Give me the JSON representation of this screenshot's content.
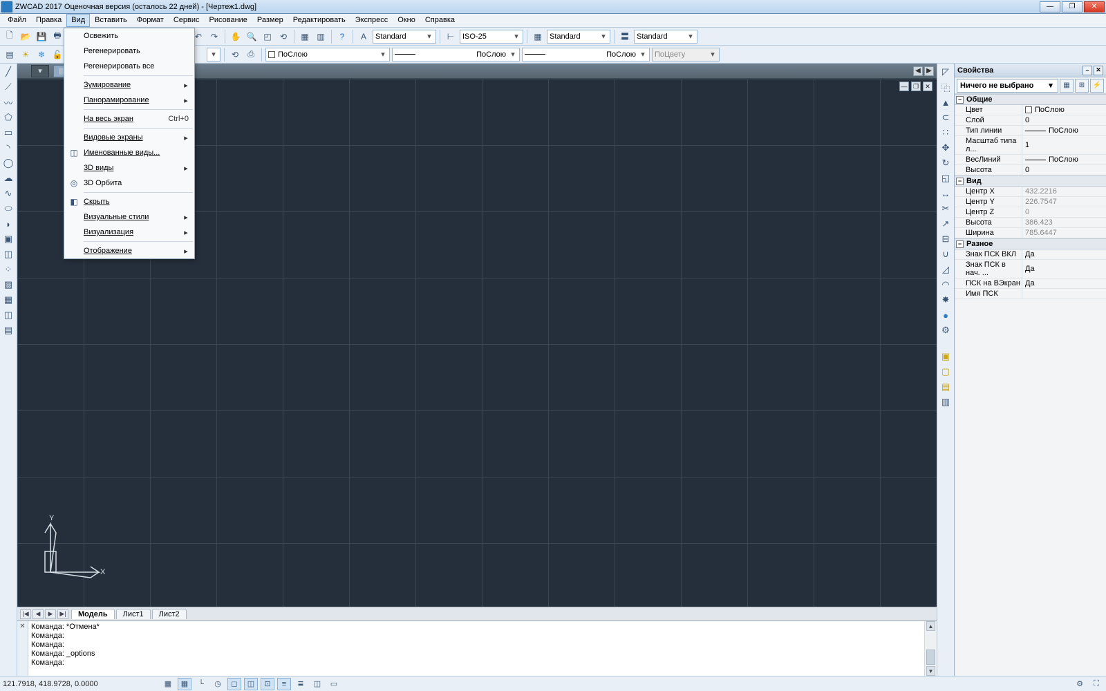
{
  "title": "ZWCAD 2017 Оценочная версия (осталось 22 дней) - [Чертеж1.dwg]",
  "menu": [
    "Файл",
    "Правка",
    "Вид",
    "Вставить",
    "Формат",
    "Сервис",
    "Рисование",
    "Размер",
    "Редактировать",
    "Экспресс",
    "Окно",
    "Справка"
  ],
  "menu_active_index": 2,
  "view_menu": {
    "refresh": "Освежить",
    "regen": "Регенерировать",
    "regen_all": "Регенерировать все",
    "zoom": "Зумирование",
    "pan": "Панорамирование",
    "fullscreen": "На весь экран",
    "fullscreen_short": "Ctrl+0",
    "viewports": "Видовые экраны",
    "named_views": "Именованные виды...",
    "views3d": "3D виды",
    "orbit": "3D Орбита",
    "hide": "Скрыть",
    "visual": "Визуальные стили",
    "render": "Визуализация",
    "display": "Отображение"
  },
  "toolbar1": {
    "text_style": "Standard",
    "dim_style": "ISO-25",
    "table_style": "Standard",
    "mline_style": "Standard"
  },
  "toolbar2": {
    "layer_color": "ПоСлою",
    "linetype": "ПоСлою",
    "lineweight": "ПоСлою",
    "plot_style": "ПоЦвету"
  },
  "sheet_tabs": {
    "nav": [
      "|◀",
      "◀",
      "▶",
      "▶|"
    ],
    "tabs": [
      "Модель",
      "Лист1",
      "Лист2"
    ],
    "active": 0
  },
  "cmd_lines": [
    "Команда: *Отмена*",
    "Команда:",
    "Команда:",
    "Команда: _options",
    "Команда:"
  ],
  "status_coords": "121.7918, 418.9728, 0.0000",
  "props": {
    "title": "Свойства",
    "selection": "Ничего не выбрано",
    "groups": {
      "general": "Общие",
      "view": "Вид",
      "misc": "Разное"
    },
    "general": {
      "color_k": "Цвет",
      "color_v": "ПоСлою",
      "layer_k": "Слой",
      "layer_v": "0",
      "ltype_k": "Тип линии",
      "ltype_v": "ПоСлою",
      "ltscale_k": "Масштаб типа л...",
      "ltscale_v": "1",
      "lweight_k": "ВесЛиний",
      "lweight_v": "ПоСлою",
      "height_k": "Высота",
      "height_v": "0"
    },
    "view": {
      "cx_k": "Центр X",
      "cx_v": "432.2216",
      "cy_k": "Центр Y",
      "cy_v": "226.7547",
      "cz_k": "Центр Z",
      "cz_v": "0",
      "h_k": "Высота",
      "h_v": "386.423",
      "w_k": "Ширина",
      "w_v": "785.6447"
    },
    "misc": {
      "ucs_on_k": "Знак ПСК ВКЛ",
      "ucs_on_v": "Да",
      "ucs_origin_k": "Знак ПСК в нач. ...",
      "ucs_origin_v": "Да",
      "ucs_vp_k": "ПСК на ВЭкран",
      "ucs_vp_v": "Да",
      "ucs_name_k": "Имя ПСК",
      "ucs_name_v": ""
    }
  }
}
